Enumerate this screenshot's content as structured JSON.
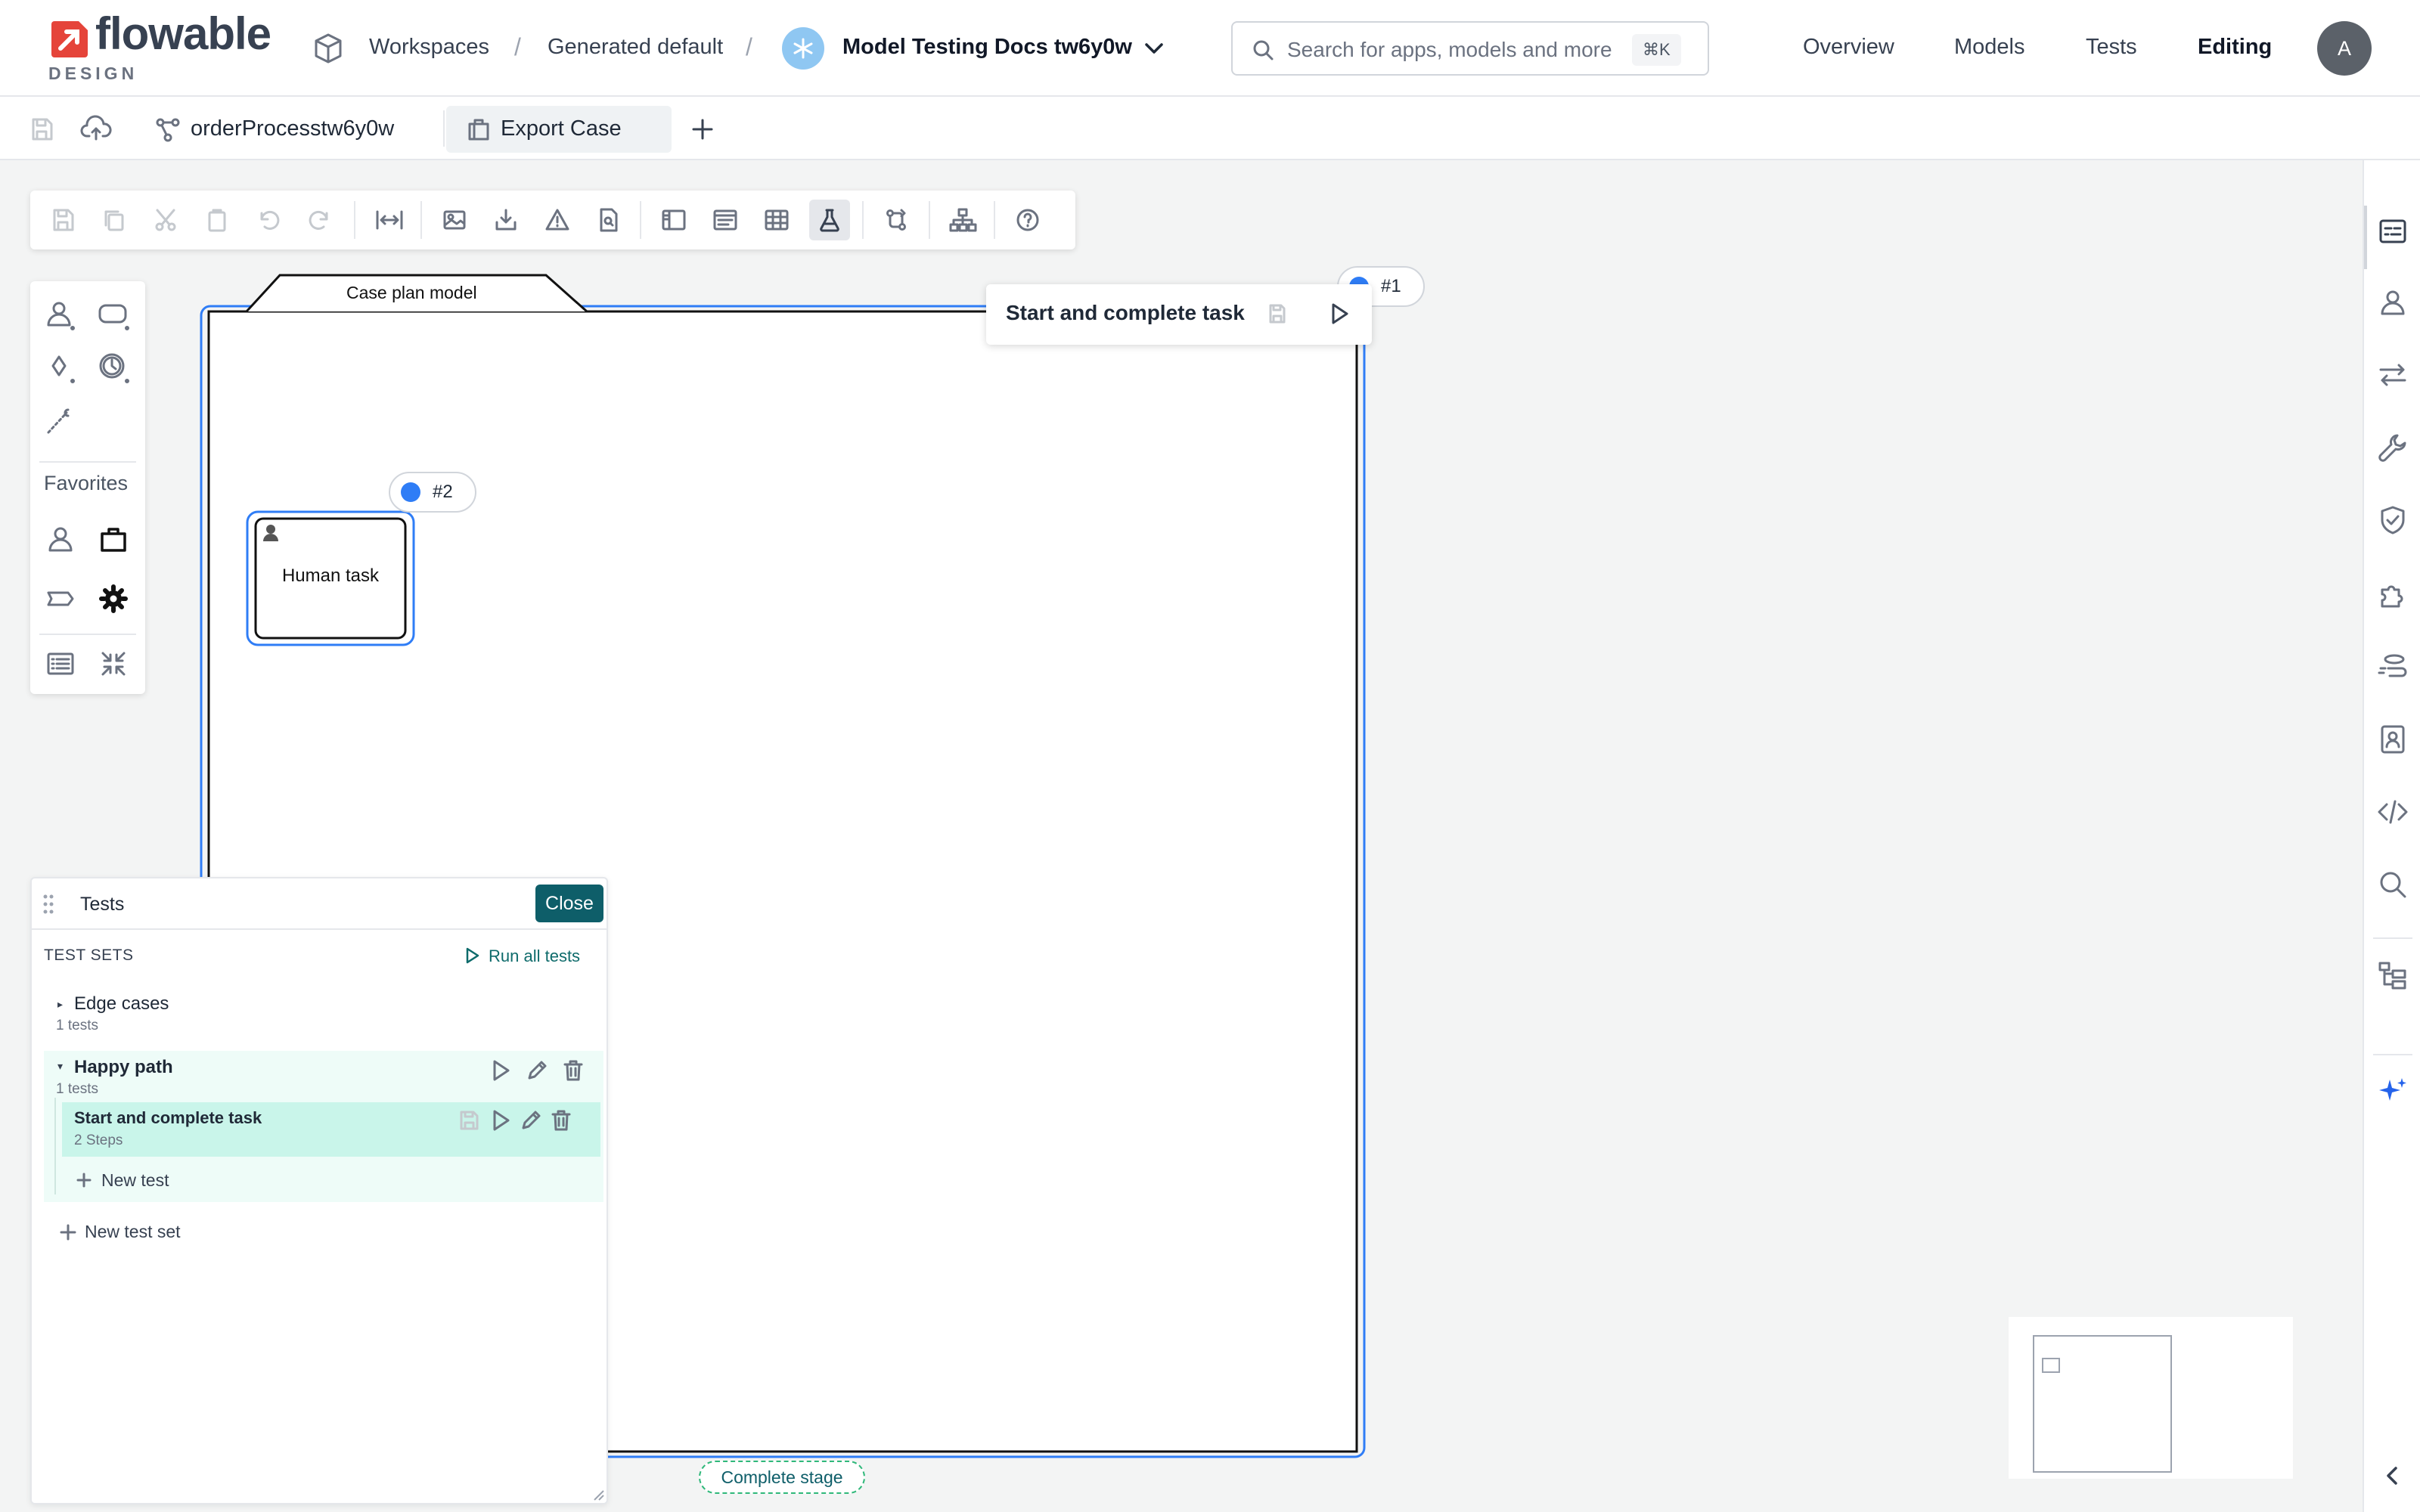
{
  "header": {
    "logo_text": "flowable",
    "logo_sub": "DESIGN",
    "breadcrumb": {
      "workspaces": "Workspaces",
      "workspace": "Generated default",
      "app": "Model Testing Docs tw6y0w"
    },
    "search": {
      "placeholder": "Search for apps, models and more",
      "shortcut": "⌘K"
    },
    "nav": {
      "overview": "Overview",
      "models": "Models",
      "tests": "Tests",
      "editing": "Editing"
    },
    "avatar_initial": "A"
  },
  "tabs": {
    "process_tab": "orderProcesstw6y0w",
    "case_tab": "Export Case"
  },
  "canvas": {
    "case_plan_label": "Case plan model",
    "plan_badge": "#1",
    "task_badge": "#2",
    "task_label": "Human task",
    "complete_stage_label": "Complete stage"
  },
  "palette": {
    "favorites_title": "Favorites"
  },
  "popup": {
    "title": "Start and complete task"
  },
  "tests_panel": {
    "title": "Tests",
    "close_label": "Close",
    "sets_header": "TEST SETS",
    "run_all": "Run all tests",
    "sets": [
      {
        "name": "Edge cases",
        "count": "1 tests"
      },
      {
        "name": "Happy path",
        "count": "1 tests"
      }
    ],
    "test": {
      "name": "Start and complete task",
      "steps": "2 Steps"
    },
    "new_test": "New test",
    "new_test_set": "New test set"
  },
  "colors": {
    "accent": "#2f7df6",
    "teal": "#0e5e69",
    "brand_red": "#e5443a",
    "selected_row": "#c9f5ea",
    "group_row": "#eefcf8"
  }
}
